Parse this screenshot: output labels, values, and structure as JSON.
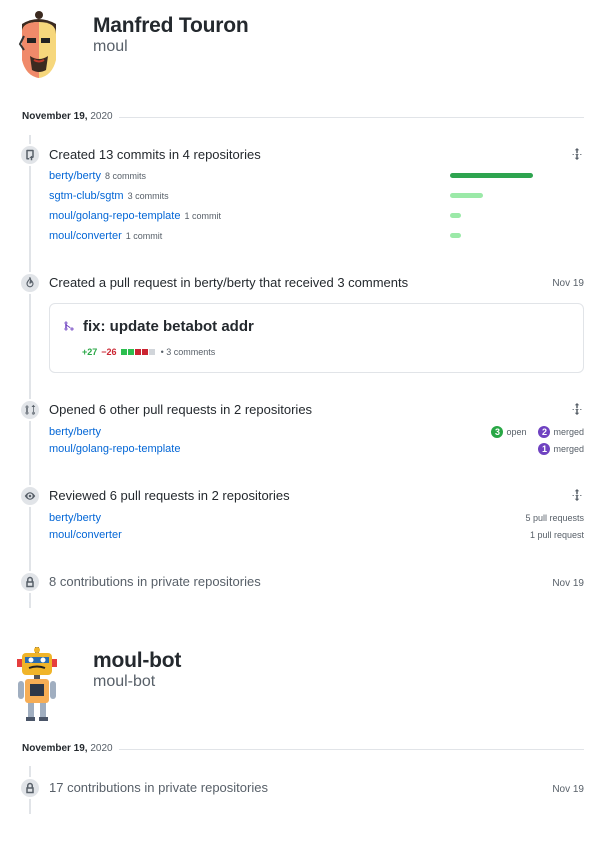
{
  "users": [
    {
      "name": "Manfred Touron",
      "login": "moul",
      "date": {
        "day": "November 19,",
        "year": "2020"
      },
      "commits_event": {
        "title": "Created 13 commits in 4 repositories",
        "repos": [
          {
            "name": "berty/berty",
            "count": "8 commits",
            "share": 8
          },
          {
            "name": "sgtm-club/sgtm",
            "count": "3 commits",
            "share": 3
          },
          {
            "name": "moul/golang-repo-template",
            "count": "1 commit",
            "share": 1
          },
          {
            "name": "moul/converter",
            "count": "1 commit",
            "share": 1
          }
        ]
      },
      "pr_event": {
        "title": "Created a pull request in berty/berty that received 3 comments",
        "date": "Nov 19",
        "pr_title": "fix: update betabot addr",
        "additions": "+27",
        "deletions": "−26",
        "comments": "3 comments"
      },
      "opened_event": {
        "title": "Opened 6 other pull requests in 2 repositories",
        "repos": [
          {
            "name": "berty/berty",
            "open_count": "3",
            "open_label": "open",
            "merged_count": "2",
            "merged_label": "merged"
          },
          {
            "name": "moul/golang-repo-template",
            "merged_count": "1",
            "merged_label": "merged"
          }
        ]
      },
      "reviewed_event": {
        "title": "Reviewed 6 pull requests in 2 repositories",
        "repos": [
          {
            "name": "berty/berty",
            "count": "5 pull requests"
          },
          {
            "name": "moul/converter",
            "count": "1 pull request"
          }
        ]
      },
      "private_event": {
        "title": "8 contributions in private repositories",
        "date": "Nov 19"
      }
    },
    {
      "name": "moul-bot",
      "login": "moul-bot",
      "date": {
        "day": "November 19,",
        "year": "2020"
      },
      "private_event": {
        "title": "17 contributions in private repositories",
        "date": "Nov 19"
      }
    }
  ],
  "icons": {
    "repo_push": "repo-push-icon",
    "pull_request": "git-pull-request-icon",
    "comment_flame": "flame-icon",
    "eye": "eye-icon",
    "lock": "lock-icon",
    "fold": "fold-icon"
  },
  "colors": {
    "link": "#0366d6",
    "commit_bar_dark": "#2ea44f",
    "commit_bar_light": "#9be9a8",
    "open": "#28a745",
    "merged": "#6f42c1",
    "additions": "#28a745",
    "deletions": "#cb2431"
  }
}
